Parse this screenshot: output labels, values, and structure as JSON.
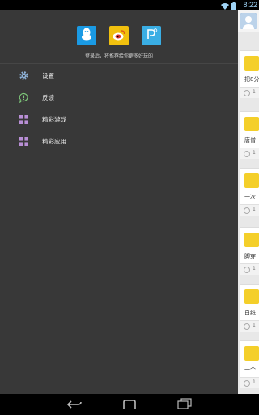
{
  "status_bar": {
    "time": "8:22",
    "icons": [
      "wifi-icon",
      "battery-icon"
    ]
  },
  "drawer": {
    "login_buttons": [
      {
        "name": "qq-login",
        "icon": "qq-icon"
      },
      {
        "name": "weibo-login",
        "icon": "weibo-icon"
      },
      {
        "name": "p-login",
        "icon": "p-icon"
      }
    ],
    "login_hint": "登录后，将推荐给你更多好玩的",
    "menu": [
      {
        "label": "设置",
        "icon": "gear-icon"
      },
      {
        "label": "反馈",
        "icon": "feedback-icon"
      },
      {
        "label": "精彩游戏",
        "icon": "grid-icon"
      },
      {
        "label": "精彩应用",
        "icon": "grid-icon"
      }
    ]
  },
  "feed": {
    "cards": [
      {
        "text": "把8分",
        "count": "1"
      },
      {
        "text": "唐僧",
        "count": "1"
      },
      {
        "text": "一次",
        "count": "1"
      },
      {
        "text": "脚穿",
        "count": "1"
      },
      {
        "text": "白纸",
        "count": "1"
      },
      {
        "text": "一个",
        "count": "1"
      }
    ]
  },
  "colors": {
    "drawer_bg": "#383838",
    "qq": "#1a9ae4",
    "weibo": "#f1c00e",
    "p": "#3aaee4",
    "accent_icon": "#8fb3d9"
  }
}
